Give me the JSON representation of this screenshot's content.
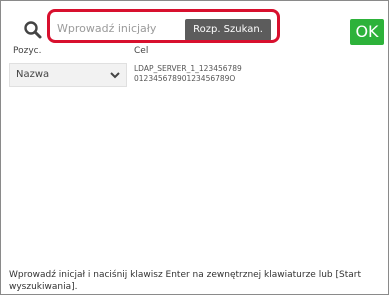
{
  "search": {
    "placeholder": "Wprowadź inicjały",
    "button_label": "Rozp. Szukan.",
    "icon": "search-icon"
  },
  "ok_label": "OK",
  "columns": {
    "position_header": "Pozyc.",
    "target_header": "Cel"
  },
  "position_select": {
    "value": "Nazwa"
  },
  "target": {
    "line1": "LDAP_SERVER_1_123456789",
    "line2": "01234567890123456789O"
  },
  "hint_text": "Wprowadź inicjał i naciśnij klawisz Enter na zewnętrznej klawiaturze lub [Start wyszukiwania].",
  "colors": {
    "highlight": "#d8102e",
    "ok_button": "#2db23a",
    "search_button": "#5c5c5c"
  }
}
